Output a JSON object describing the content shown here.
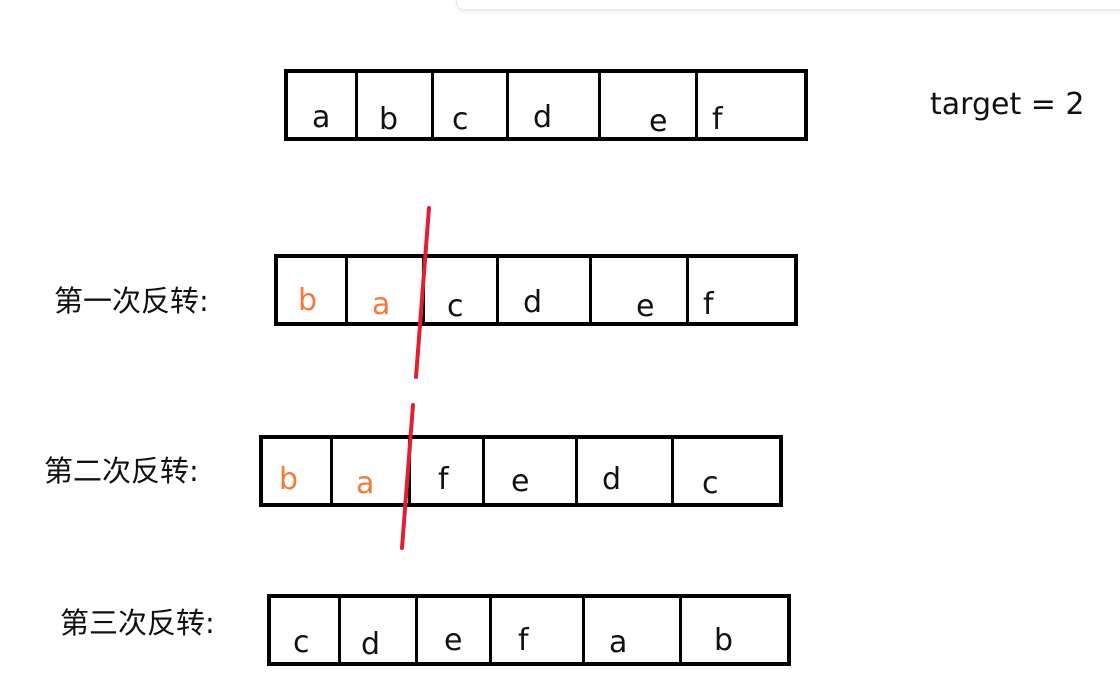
{
  "target_label": "target = 2",
  "accent_colors": {
    "highlight": "#f07b3a",
    "cut_line": "#e02030"
  },
  "rows": [
    {
      "label": "",
      "cells": [
        {
          "text": "a",
          "highlight": false
        },
        {
          "text": "b",
          "highlight": false
        },
        {
          "text": "c",
          "highlight": false
        },
        {
          "text": "d",
          "highlight": false
        },
        {
          "text": "e",
          "highlight": false
        },
        {
          "text": "f",
          "highlight": false
        }
      ]
    },
    {
      "label": "第一次反转:",
      "cells": [
        {
          "text": "b",
          "highlight": true
        },
        {
          "text": "a",
          "highlight": true
        },
        {
          "text": "c",
          "highlight": false
        },
        {
          "text": "d",
          "highlight": false
        },
        {
          "text": "e",
          "highlight": false
        },
        {
          "text": "f",
          "highlight": false
        }
      ]
    },
    {
      "label": "第二次反转:",
      "cells": [
        {
          "text": "b",
          "highlight": true
        },
        {
          "text": "a",
          "highlight": true
        },
        {
          "text": "f",
          "highlight": false
        },
        {
          "text": "e",
          "highlight": false
        },
        {
          "text": "d",
          "highlight": false
        },
        {
          "text": "c",
          "highlight": false
        }
      ]
    },
    {
      "label": "第三次反转:",
      "cells": [
        {
          "text": "c",
          "highlight": false
        },
        {
          "text": "d",
          "highlight": false
        },
        {
          "text": "e",
          "highlight": false
        },
        {
          "text": "f",
          "highlight": false
        },
        {
          "text": "a",
          "highlight": false
        },
        {
          "text": "b",
          "highlight": false
        }
      ]
    }
  ]
}
